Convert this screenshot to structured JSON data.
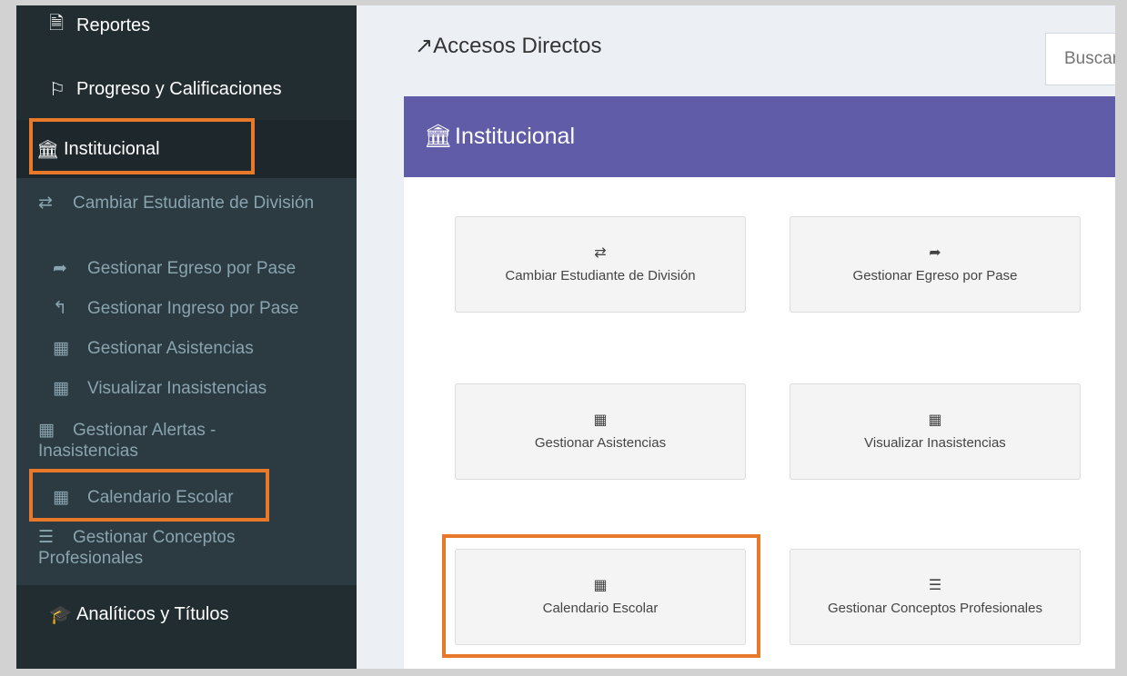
{
  "sidebar": {
    "top_items": [
      {
        "label": "Reportes",
        "icon": "file-icon",
        "glyph": "🗎"
      },
      {
        "label": "Progreso y Calificaciones",
        "icon": "flag-icon",
        "glyph": "⚐"
      },
      {
        "label": "Institucional",
        "icon": "bank-icon",
        "glyph": "🏛"
      },
      {
        "label": "Analíticos y Títulos",
        "icon": "graduation-cap-icon",
        "glyph": "🎓"
      }
    ],
    "sub_items": [
      {
        "label": "Cambiar Estudiante de División",
        "icon": "retweet-icon",
        "glyph": "⇄"
      },
      {
        "label": "Gestionar Egreso por Pase",
        "icon": "share-icon",
        "glyph": "➦"
      },
      {
        "label": "Gestionar Ingreso por Pase",
        "icon": "reply-icon",
        "glyph": "↰"
      },
      {
        "label": "Gestionar Asistencias",
        "icon": "calendar-icon",
        "glyph": "▦"
      },
      {
        "label": "Visualizar Inasistencias",
        "icon": "calendar-icon",
        "glyph": "▦"
      },
      {
        "label": "Gestionar Alertas - Inasistencias",
        "icon": "calendar-icon",
        "glyph": "▦"
      },
      {
        "label": "Calendario Escolar",
        "icon": "calendar-icon",
        "glyph": "▦"
      },
      {
        "label": "Gestionar Conceptos Profesionales",
        "icon": "list-icon",
        "glyph": "☰"
      }
    ]
  },
  "main": {
    "title": "Accesos Directos",
    "title_glyph": "↗",
    "search_placeholder": "Buscar",
    "box_title": "Institucional",
    "box_glyph": "🏛",
    "tiles": [
      {
        "label": "Cambiar Estudiante de División",
        "icon": "retweet-icon",
        "glyph": "⇄"
      },
      {
        "label": "Gestionar Egreso por Pase",
        "icon": "share-icon",
        "glyph": "➦"
      },
      {
        "label": "Gestionar Asistencias",
        "icon": "calendar-icon",
        "glyph": "▦"
      },
      {
        "label": "Visualizar Inasistencias",
        "icon": "calendar-icon",
        "glyph": "▦"
      },
      {
        "label": "Calendario Escolar",
        "icon": "calendar-icon",
        "glyph": "▦"
      },
      {
        "label": "Gestionar Conceptos Profesionales",
        "icon": "list-icon",
        "glyph": "☰"
      }
    ]
  },
  "colors": {
    "sidebar_bg": "#222d32",
    "submenu_bg": "#2c3b41",
    "box_header_bg": "#605ca8",
    "highlight": "#e8782a"
  }
}
